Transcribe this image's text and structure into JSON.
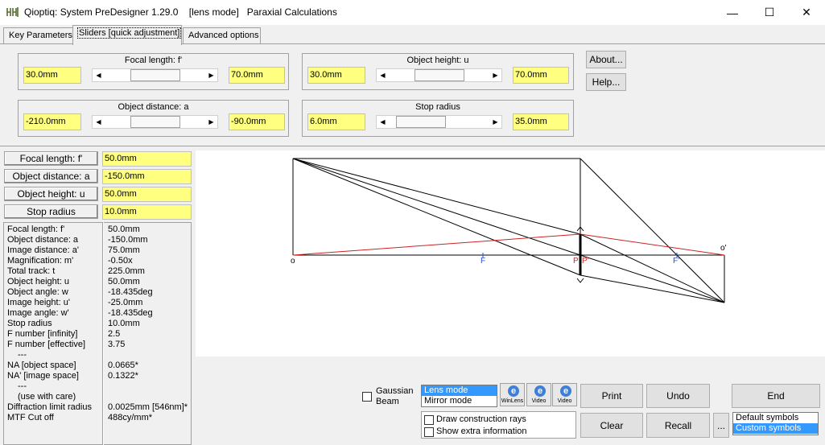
{
  "window": {
    "title": "Qioptiq: System PreDesigner 1.29.0    [lens mode]   Paraxial Calculations",
    "minimize": "—",
    "maximize": "☐",
    "close": "✕"
  },
  "tabs": [
    {
      "label": "Key Parameters"
    },
    {
      "label": "Sliders [quick adjustment]"
    },
    {
      "label": "Advanced options"
    }
  ],
  "sliders": {
    "focal": {
      "title": "Focal length: f'",
      "min": "30.0mm",
      "max": "70.0mm",
      "position": 0.5
    },
    "object_height": {
      "title": "Object height: u",
      "min": "30.0mm",
      "max": "70.0mm",
      "position": 0.5
    },
    "object_distance": {
      "title": "Object distance: a",
      "min": "-210.0mm",
      "max": "-90.0mm",
      "position": 0.5
    },
    "stop_radius": {
      "title": "Stop radius",
      "min": "6.0mm",
      "max": "35.0mm",
      "position": 0.14
    }
  },
  "buttons": {
    "about": "About...",
    "help": "Help...",
    "print": "Print",
    "undo": "Undo",
    "end": "End",
    "clear": "Clear",
    "recall": "Recall",
    "more": "..."
  },
  "params": [
    {
      "label": "Focal length: f'",
      "value": "50.0mm"
    },
    {
      "label": "Object distance: a",
      "value": "-150.0mm"
    },
    {
      "label": "Object height: u",
      "value": "50.0mm"
    },
    {
      "label": "Stop radius",
      "value": "10.0mm"
    }
  ],
  "info": [
    {
      "label": "Focal length: f'",
      "value": "50.0mm"
    },
    {
      "label": "Object distance: a",
      "value": "-150.0mm"
    },
    {
      "label": "Image distance: a'",
      "value": "75.0mm"
    },
    {
      "label": "Magnification: m'",
      "value": "-0.50x"
    },
    {
      "label": "Total track: t",
      "value": "225.0mm"
    },
    {
      "label": "Object height: u",
      "value": "50.0mm"
    },
    {
      "label": "Object angle: w",
      "value": "-18.435deg"
    },
    {
      "label": "Image height: u'",
      "value": "-25.0mm"
    },
    {
      "label": "Image angle: w'",
      "value": "-18.435deg"
    },
    {
      "label": "Stop radius",
      "value": "10.0mm"
    },
    {
      "label": "F number [infinity]",
      "value": "2.5"
    },
    {
      "label": "F number [effective]",
      "value": "3.75"
    },
    {
      "label": "---",
      "value": ""
    },
    {
      "label": "NA [object space]",
      "value": "0.0665*"
    },
    {
      "label": "NA' [image space]",
      "value": "0.1322*"
    },
    {
      "label": "---",
      "value": ""
    },
    {
      "label": "(use with care)",
      "value": ""
    },
    {
      "label": "Diffraction limit radius",
      "value": "0.0025mm [546nm]*"
    },
    {
      "label": "MTF Cut off",
      "value": "488cy/mm*"
    }
  ],
  "diagram": {
    "object_label": "o",
    "image_label": "o'",
    "front_focus_label": "F",
    "back_focus_label": "F'",
    "principal_label": "P",
    "principal_prime_label": "P'"
  },
  "options": {
    "gaussian_beam": "Gaussian\nBeam",
    "mode_list": [
      {
        "label": "Lens mode",
        "selected": true
      },
      {
        "label": "Mirror mode",
        "selected": false
      }
    ],
    "draw_construction_rays": "Draw construction rays",
    "show_extra_information": "Show extra information",
    "symbols_list": [
      {
        "label": "Default symbols",
        "selected": false
      },
      {
        "label": "Custom symbols",
        "selected": true
      }
    ],
    "winlens_label": "WinLens",
    "video1_label": "Video",
    "video2_label": "Video"
  },
  "colors": {
    "field_yellow": "#ffff80",
    "ray_red": "#cc2222",
    "focus_blue": "#2a4bcc",
    "selection_blue": "#3399ff"
  }
}
